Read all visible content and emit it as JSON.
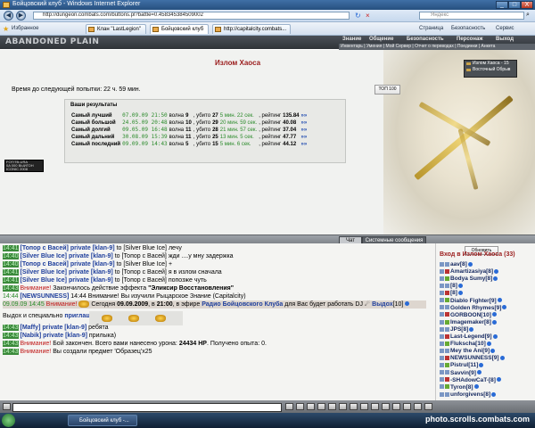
{
  "window": {
    "title": "Бойцовский клуб - Windows Internet Explorer",
    "min": "_",
    "max": "□",
    "close": "X"
  },
  "address": {
    "url": "http://dungeon.combats.com/buttons.pl?battle=0.458345384509002",
    "search_placeholder": "Яндекс"
  },
  "tabs": [
    {
      "label": "Избранное"
    },
    {
      "label": "Клан \"LastLegion\""
    },
    {
      "label": "Бойцовский клуб"
    },
    {
      "label": "http://capitalcity.combats..."
    }
  ],
  "commands": [
    "Страница",
    "Безопасность",
    "Сервис"
  ],
  "game_header": {
    "logo": "ABANDONED PLAIN",
    "nav": [
      "Знание",
      "Общение",
      "Безопасность",
      "Персонаж",
      "Выход"
    ],
    "subnav": "Инвентарь | Умения | Мой Сервер | Отчет о переводах | Поединки | Анкета"
  },
  "page": {
    "title": "Излом Хаоса",
    "wait_label": "Время до следующей попытки: 22 ч. 59 мин.",
    "top_button": "ТОП 100",
    "map_items": [
      "Излом Хаоса - 15",
      "Восточный Обрыв"
    ],
    "counter_lines": [
      "FOTITB-URA",
      "0A 000 ВЫИГОН",
      "ICONIC 2008"
    ]
  },
  "results": {
    "title": "Ваши результаты",
    "rows": [
      {
        "label": "Самый лучший",
        "date": "07.09.09 21:50",
        "wave_text": "волна",
        "wave": "9",
        "kills_text": ", убито",
        "kills": "27",
        "time": "5 мин. 22 сек.",
        "rating_text": ", рейтинг",
        "rating": "135.84",
        "arrow": "»»"
      },
      {
        "label": "Самый большой",
        "date": "24.05.09 20:48",
        "wave_text": "волна",
        "wave": "10",
        "kills_text": ", убито",
        "kills": "29",
        "time": "20 мин. 59 сек.",
        "rating_text": ", рейтинг",
        "rating": "40.08",
        "arrow": "»»"
      },
      {
        "label": "Самый долгий",
        "date": "09.05.09 16:48",
        "wave_text": "волна",
        "wave": "11",
        "kills_text": ", убито",
        "kills": "28",
        "time": "21 мин. 57 сек.",
        "rating_text": ", рейтинг",
        "rating": "37.04",
        "arrow": "»»"
      },
      {
        "label": "Самый дальний",
        "date": "30.08.09 15:39",
        "wave_text": "волна",
        "wave": "11",
        "kills_text": ", убито",
        "kills": "25",
        "time": "13 мин. 5 сек.",
        "rating_text": ", рейтинг",
        "rating": "47.77",
        "arrow": "»»"
      },
      {
        "label": "Самый последний",
        "date": "09.09.09 14:43",
        "wave_text": "волна",
        "wave": "5",
        "kills_text": ", убито",
        "kills": "15",
        "time": "5 мин. 6 сек.",
        "rating_text": ", рейтинг",
        "rating": "44.12",
        "arrow": "»»"
      }
    ]
  },
  "chat_tabs": {
    "chat": "Чат",
    "system": "Системные сообщения"
  },
  "chat": {
    "l1": {
      "time": "14:41",
      "from": "[Топор с Васей]",
      "priv": "private [klan-9]",
      "to": "to [Silver Blue Ice]",
      "text": "лечу"
    },
    "l2": {
      "time": "14:40",
      "from": "[Silver Blue Ice]",
      "priv": "private [klan-9]",
      "to": "to [Топор с Васей]",
      "text": "жди ....у мну задержка"
    },
    "l3": {
      "time": "14:40",
      "from": "[Топор с Васей]",
      "priv": "private [klan-9]",
      "to": "to [Silver Blue Ice]",
      "text": "+"
    },
    "l4": {
      "time": "14:41",
      "from": "[Silver Blue Ice]",
      "priv": "private [klan-9]",
      "to": "to [Топор с Васей]",
      "text": "я в излом сначала"
    },
    "l5": {
      "time": "14:41",
      "from": "[Silver Blue Ice]",
      "priv": "private [klan-9]",
      "to": "to [Топор с Васей]",
      "text": "попозже чуть"
    },
    "l6": {
      "time": "14:43",
      "warn": "Внимание!",
      "text": "Закончилось действие эффекта",
      "bold": "\"Эликсир Восстановления\""
    },
    "l7": {
      "time": "14:44",
      "name": "[NEWSUNNESS]",
      "text": "14:44 Внимание! Вы изучили Рыцарское Знание (Capitalcity)"
    },
    "l8": {
      "time": "09.09.09 14:45",
      "warn": "Внимание!",
      "pre": "Сегодня",
      "date": "09.09.2009",
      "mid": ", в",
      "hour": "21:00",
      "in": ", в эфире",
      "radio": "Радио Бойцовского Клуба",
      "post": "для Вас будет работать DJ",
      "dj": "Выдох",
      "lvl": "[10]"
    },
    "l9": {
      "text": "Выдох и специально",
      "bold": "приглашённый гость."
    },
    "l10": {
      "time": "14:43",
      "from": "[Maffy]",
      "priv": "private [klan-9]",
      "text": "ребята"
    },
    "l11": {
      "time": "14:43",
      "from": "[Nabik]",
      "priv": "private [klan-9]",
      "text": "прилыка)"
    },
    "l12": {
      "time": "14:43",
      "warn": "Внимание!",
      "text": "Бой закончен. Всего вами нанесено урона:",
      "dmg": "24434 HP",
      "rest": ". Получено опыта: 0."
    },
    "l13": {
      "time": "14:43",
      "warn": "Внимание!",
      "text": "Вы создали предмет 'Образец'x25"
    }
  },
  "online": {
    "refresh": "Обновить",
    "title": "Вход в Излом Хаоса (33)",
    "players": [
      "aav[8]",
      "Amartizasiya[8]",
      "Bodya Sumy[8]",
      "[8]",
      "[8]",
      "Diablo Fighter[9]",
      "Golden Rhymes[9]",
      "GORBOON[10]",
      "Imagemaker[8]",
      "JPS[8]",
      "Last-Legend[9]",
      "Flukscha[10]",
      "Mey the Ani[9]",
      "NEWSUNNESS[9]",
      "Pistrul[11]",
      "Savvin[9]",
      "-SHAdowCaT-[8]",
      "Tyron[8]",
      "unforgivens[8]"
    ]
  },
  "watermark": "photo.scrolls.combats.com",
  "taskbar": {
    "app": "Бойцовский клуб -..."
  }
}
